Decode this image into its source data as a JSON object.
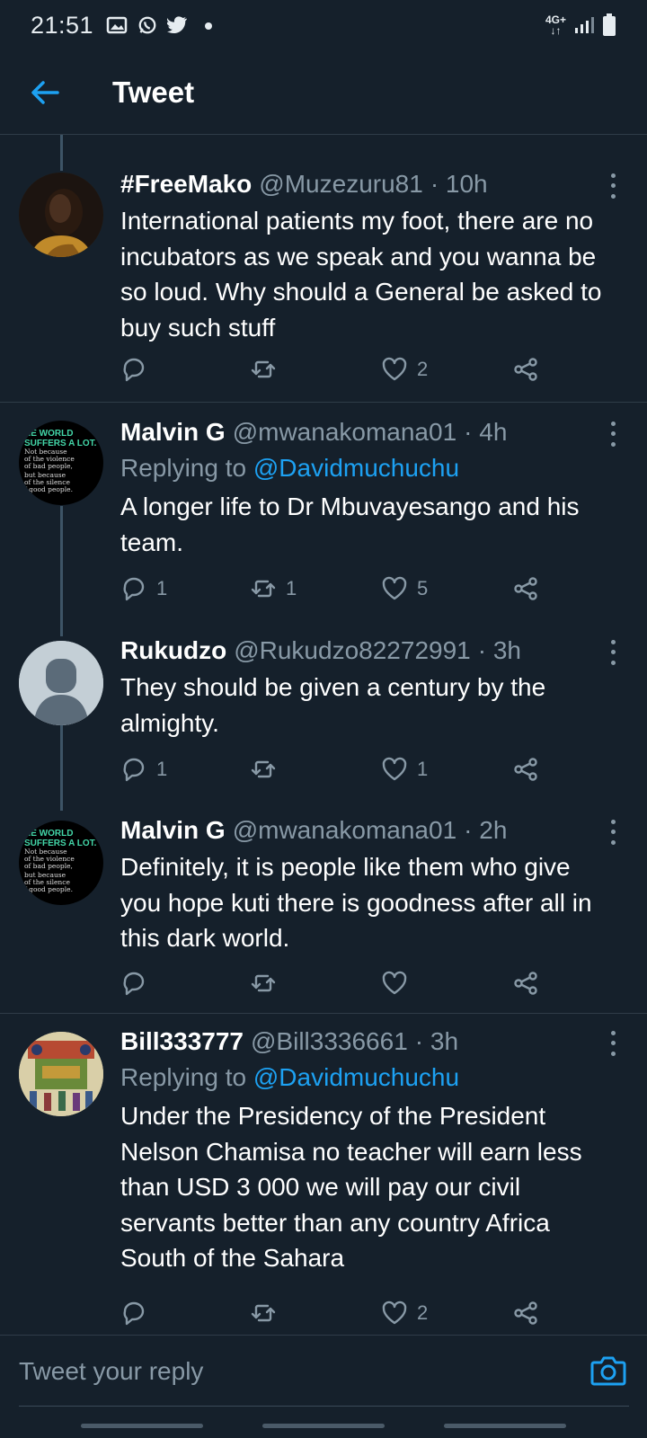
{
  "status_bar": {
    "time": "21:51",
    "icons": [
      "gallery-icon",
      "whatsapp-icon",
      "twitter-icon",
      "dot-icon"
    ],
    "network_top": "4G+",
    "network_bottom": "↓↑"
  },
  "app_bar": {
    "title": "Tweet",
    "back_icon": "arrow-left-icon"
  },
  "tweets": [
    {
      "name": "#FreeMako",
      "handle": "@Muzezuru81",
      "time": "· 10h",
      "text": "International patients my foot, there are no incubators as we speak and you wanna be so loud. Why should a General be asked to buy such stuff",
      "replies": "",
      "retweets": "",
      "likes": "2"
    },
    {
      "name": "Malvin G",
      "handle": "@mwanakomana01",
      "time": "· 4h",
      "replying_label": "Replying to",
      "replying_to": "@Davidmuchuchu",
      "text": "A longer life to Dr Mbuvayesango and his team.",
      "replies": "1",
      "retweets": "1",
      "likes": "5",
      "avatar_text": [
        "HE WORLD",
        "SUFFERS A LOT.",
        "Not because",
        "of the violence",
        "of bad people,",
        "but because",
        "of the silence",
        "f good people."
      ]
    },
    {
      "name": "Rukudzo",
      "handle": "@Rukudzo82272991",
      "time": "· 3h",
      "text": "They should be given a century by the almighty.",
      "replies": "1",
      "retweets": "",
      "likes": "1"
    },
    {
      "name": "Malvin G",
      "handle": "@mwanakomana01",
      "time": "· 2h",
      "text": "Definitely, it is people like them who give you hope kuti there is goodness after all in this dark world.",
      "replies": "",
      "retweets": "",
      "likes": "",
      "avatar_text": [
        "HE WORLD",
        "SUFFERS A LOT.",
        "Not because",
        "of the violence",
        "of bad people,",
        "but because",
        "of the silence",
        "f good people."
      ]
    },
    {
      "name": "Bill333777",
      "handle": "@Bill3336661",
      "time": "· 3h",
      "replying_label": "Replying to",
      "replying_to": "@Davidmuchuchu",
      "text": "Under the Presidency of the President Nelson Chamisa no teacher will earn less than USD 3 000 we will pay our civil servants better than any country Africa South of the Sahara",
      "replies": "",
      "retweets": "",
      "likes": "2"
    }
  ],
  "composer": {
    "placeholder": "Tweet your reply",
    "camera_icon": "camera-icon"
  },
  "colors": {
    "background": "#15202b",
    "secondary_text": "#8899a6",
    "accent": "#1da1f2",
    "divider": "#2f3c48"
  }
}
